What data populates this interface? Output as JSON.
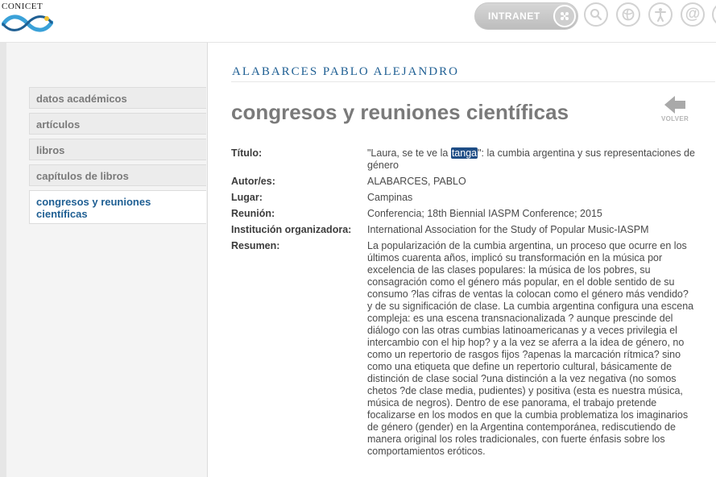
{
  "header": {
    "logo_text": "CONICET",
    "intranet_label": "INTRANET",
    "icons": [
      "network-icon",
      "search-icon",
      "globe-icon",
      "accessibility-icon",
      "at-icon"
    ]
  },
  "sidebar": {
    "items": [
      {
        "label": "datos académicos"
      },
      {
        "label": "artículos"
      },
      {
        "label": "libros"
      },
      {
        "label": "capítulos de libros"
      },
      {
        "label": "congresos y reuniones científicas"
      }
    ]
  },
  "main": {
    "person_name": "ALABARCES PABLO ALEJANDRO",
    "section_title": "congresos y reuniones científicas",
    "back_label": "VOLVER",
    "fields": {
      "titulo_label": "Título:",
      "titulo_before": "\"Laura, se te ve la ",
      "titulo_highlight": "tanga",
      "titulo_after": "\": la cumbia argentina y sus representaciones de género",
      "autor_label": "Autor/es:",
      "autor_value": "ALABARCES, PABLO",
      "lugar_label": "Lugar:",
      "lugar_value": "Campinas",
      "reunion_label": "Reunión:",
      "reunion_value": "Conferencia; 18th Biennial IASPM Conference; 2015",
      "institucion_label": "Institución organizadora:",
      "institucion_value": "International Association for the Study of Popular Music-IASPM",
      "resumen_label": "Resumen:",
      "resumen_value": "La popularización de la cumbia argentina, un proceso que ocurre en los últimos cuarenta años, implicó su transformación en la música por excelencia de las clases populares: la música de los pobres, su consagración como el género más popular, en el doble sentido de su consumo ?las cifras de ventas la colocan como el género más vendido? y de su significación de clase. La cumbia argentina configura una escena compleja: es una escena transnacionalizada ? aunque prescinde del diálogo con las otras cumbias latinoamericanas y a veces privilegia el intercambio con el hip hop? y a la vez se aferra a la idea de género, no como un repertorio de rasgos fijos ?apenas la marcación rítmica? sino como una etiqueta que define un repertorio cultural, básicamente de distinción de clase social ?una distinción a la vez negativa (no somos chetos ?de clase media, pudientes) y positiva (esta es nuestra música, música de negros). Dentro de ese panorama, el trabajo pretende focalizarse en los modos en que la cumbia problematiza los imaginarios de género (gender) en la Argentina contemporánea, rediscutiendo de manera original los roles tradicionales, con fuerte énfasis sobre los comportamientos eróticos."
    }
  },
  "colors": {
    "accent_blue": "#1f5f93",
    "highlight_bg": "#1f4e86",
    "logo_wave_blue": "#3aa1d8"
  }
}
